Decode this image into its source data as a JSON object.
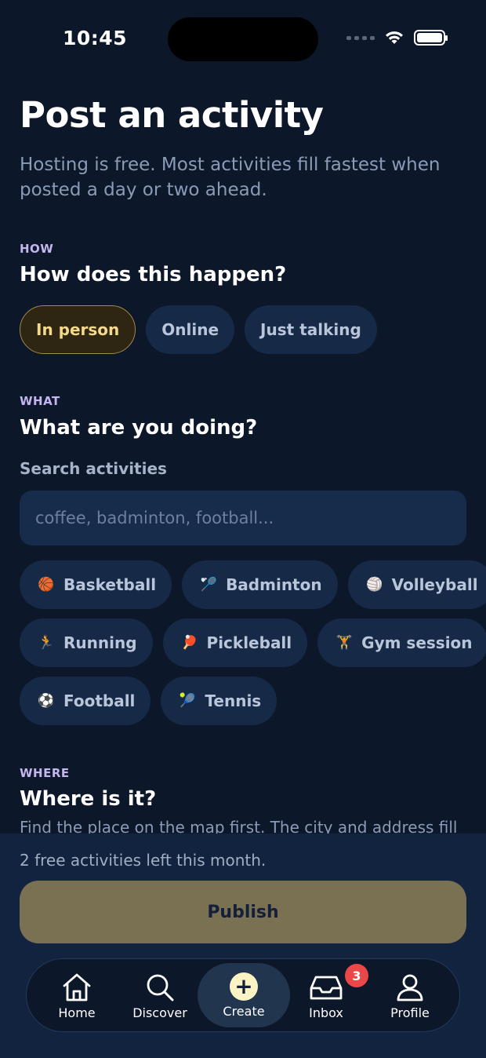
{
  "status_bar": {
    "time": "10:45"
  },
  "page": {
    "title": "Post an activity",
    "subtitle": "Hosting is free. Most activities fill fastest when posted a day or two ahead."
  },
  "how": {
    "kicker": "HOW",
    "title": "How does this happen?",
    "options": [
      "In person",
      "Online",
      "Just talking"
    ],
    "selected": "In person"
  },
  "what": {
    "kicker": "WHAT",
    "title": "What are you doing?",
    "search_label": "Search activities",
    "search_placeholder": "coffee, badminton, football...",
    "search_value": "",
    "suggestions": [
      {
        "label": "Basketball",
        "emoji": "🏀"
      },
      {
        "label": "Badminton",
        "emoji": "🏸"
      },
      {
        "label": "Volleyball",
        "emoji": "🏐"
      },
      {
        "label": "Running",
        "emoji": "🏃"
      },
      {
        "label": "Pickleball",
        "emoji": "🏓"
      },
      {
        "label": "Gym session",
        "emoji": "🏋"
      },
      {
        "label": "Football",
        "emoji": "⚽"
      },
      {
        "label": "Tennis",
        "emoji": "🎾"
      }
    ]
  },
  "where": {
    "kicker": "WHERE",
    "title": "Where is it?",
    "description": "Find the place on the map first. The city and address fill"
  },
  "footer": {
    "free_left": "2 free activities left this month.",
    "publish_label": "Publish"
  },
  "tab_bar": {
    "items": [
      {
        "label": "Home",
        "icon": "home-icon"
      },
      {
        "label": "Discover",
        "icon": "search-icon"
      },
      {
        "label": "Create",
        "icon": "plus-icon",
        "active": true
      },
      {
        "label": "Inbox",
        "icon": "inbox-icon",
        "badge": "3"
      },
      {
        "label": "Profile",
        "icon": "person-icon"
      }
    ]
  },
  "colors": {
    "background": "#0c1729",
    "chip": "#162a48",
    "selected_chip_border": "#a08a45",
    "publish": "#7a7152",
    "kicker": "#c3b6ef",
    "badge": "#ea4848"
  }
}
